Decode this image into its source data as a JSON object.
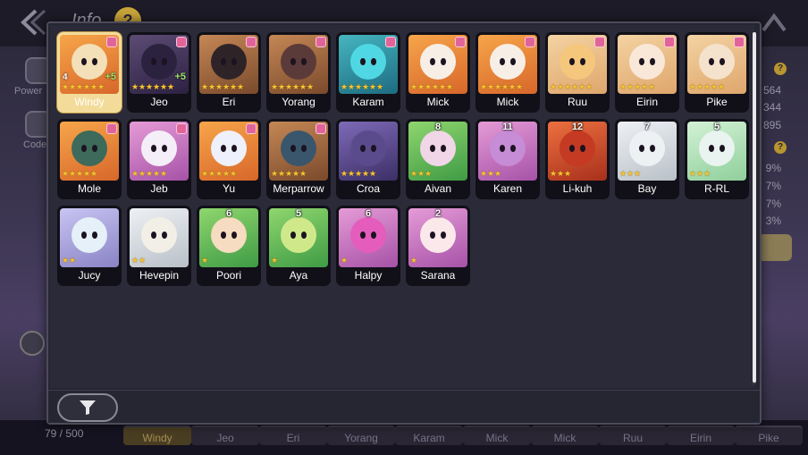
{
  "background": {
    "title": "Info",
    "help_glyph": "?",
    "side_items": [
      {
        "label": "Power",
        "icon": "power-icon"
      },
      {
        "label": "Code",
        "icon": "codex-icon"
      }
    ],
    "right_values": [
      "564",
      "344",
      "895",
      "9%",
      "7%",
      "7%",
      "3%"
    ],
    "collection_count": "79 / 500",
    "bottom_names": [
      "Windy",
      "Jeo",
      "Eri",
      "Yorang",
      "Karam",
      "Mick",
      "Mick",
      "Ruu",
      "Eirin",
      "Pike"
    ]
  },
  "modal": {
    "filter_icon": "funnel-icon",
    "cards": [
      {
        "name": "Windy",
        "stars": 6,
        "star_color": "gold",
        "level": "",
        "corner": "4",
        "plus": "+5",
        "theme": "t-orange",
        "blob": "#f3e0b8",
        "selected": true,
        "mark": true
      },
      {
        "name": "Jeo",
        "stars": 6,
        "star_color": "gold",
        "level": "",
        "corner": "",
        "plus": "+5",
        "theme": "t-dark",
        "blob": "#2b2240",
        "selected": false,
        "mark": true
      },
      {
        "name": "Eri",
        "stars": 6,
        "star_color": "gold",
        "level": "",
        "corner": "",
        "plus": "",
        "theme": "t-brown",
        "blob": "#2e2428",
        "selected": false,
        "mark": true
      },
      {
        "name": "Yorang",
        "stars": 6,
        "star_color": "gold",
        "level": "",
        "corner": "",
        "plus": "",
        "theme": "t-brown",
        "blob": "#5b3a3a",
        "selected": false,
        "mark": true
      },
      {
        "name": "Karam",
        "stars": 6,
        "star_color": "gold",
        "level": "",
        "corner": "",
        "plus": "",
        "theme": "t-teal",
        "blob": "#4fd8e3",
        "selected": false,
        "mark": true
      },
      {
        "name": "Mick",
        "stars": 6,
        "star_color": "gold",
        "level": "",
        "corner": "",
        "plus": "",
        "theme": "t-orange",
        "blob": "#f7efe6",
        "selected": false,
        "mark": true
      },
      {
        "name": "Mick",
        "stars": 6,
        "star_color": "gold",
        "level": "",
        "corner": "",
        "plus": "",
        "theme": "t-orange",
        "blob": "#f7efe6",
        "selected": false,
        "mark": true
      },
      {
        "name": "Ruu",
        "stars": 6,
        "star_color": "gold",
        "level": "",
        "corner": "",
        "plus": "",
        "theme": "t-cream",
        "blob": "#f5c77c",
        "selected": false,
        "mark": true
      },
      {
        "name": "Eirin",
        "stars": 5,
        "star_color": "gold",
        "level": "",
        "corner": "",
        "plus": "",
        "theme": "t-cream",
        "blob": "#f9e7d8",
        "selected": false,
        "mark": true
      },
      {
        "name": "Pike",
        "stars": 5,
        "star_color": "gold",
        "level": "",
        "corner": "",
        "plus": "",
        "theme": "t-cream",
        "blob": "#f5e2cc",
        "selected": false,
        "mark": true
      },
      {
        "name": "Mole",
        "stars": 5,
        "star_color": "gold",
        "level": "",
        "corner": "",
        "plus": "",
        "theme": "t-orange",
        "blob": "#3d6a5a",
        "selected": false,
        "mark": true
      },
      {
        "name": "Jeb",
        "stars": 5,
        "star_color": "gold",
        "level": "",
        "corner": "",
        "plus": "",
        "theme": "t-pink",
        "blob": "#f4eef8",
        "selected": false,
        "mark": true
      },
      {
        "name": "Yu",
        "stars": 5,
        "star_color": "gold",
        "level": "",
        "corner": "",
        "plus": "",
        "theme": "t-orange",
        "blob": "#eef0fb",
        "selected": false,
        "mark": true
      },
      {
        "name": "Merparrow",
        "stars": 5,
        "star_color": "gold",
        "level": "",
        "corner": "",
        "plus": "",
        "theme": "t-brown",
        "blob": "#3a566d",
        "selected": false,
        "mark": true
      },
      {
        "name": "Croa",
        "stars": 5,
        "star_color": "gold",
        "level": "",
        "corner": "",
        "plus": "",
        "theme": "t-violet",
        "blob": "#5a4c8c",
        "selected": false,
        "mark": false
      },
      {
        "name": "Aivan",
        "stars": 3,
        "star_color": "gold",
        "level": "8",
        "corner": "",
        "plus": "",
        "theme": "t-green",
        "blob": "#f0d6e6",
        "selected": false,
        "mark": false
      },
      {
        "name": "Karen",
        "stars": 3,
        "star_color": "gold",
        "level": "11",
        "corner": "",
        "plus": "",
        "theme": "t-pink",
        "blob": "#c68cd6",
        "selected": false,
        "mark": false
      },
      {
        "name": "Li-kuh",
        "stars": 3,
        "star_color": "gold",
        "level": "12",
        "corner": "",
        "plus": "",
        "theme": "t-red",
        "blob": "#c43a22",
        "selected": false,
        "mark": false
      },
      {
        "name": "Bay",
        "stars": 3,
        "star_color": "gold",
        "level": "7",
        "corner": "",
        "plus": "",
        "theme": "t-white",
        "blob": "#eef1f4",
        "selected": false,
        "mark": false
      },
      {
        "name": "R-RL",
        "stars": 3,
        "star_color": "gold",
        "level": "5",
        "corner": "",
        "plus": "",
        "theme": "t-mint",
        "blob": "#e9f3ef",
        "selected": false,
        "mark": false
      },
      {
        "name": "Jucy",
        "stars": 2,
        "star_color": "gold",
        "level": "",
        "corner": "",
        "plus": "",
        "theme": "t-lav",
        "blob": "#e6f0f8",
        "selected": false,
        "mark": false
      },
      {
        "name": "Hevepin",
        "stars": 2,
        "star_color": "gold",
        "level": "",
        "corner": "",
        "plus": "",
        "theme": "t-white",
        "blob": "#f2efe6",
        "selected": false,
        "mark": false
      },
      {
        "name": "Poori",
        "stars": 1,
        "star_color": "gold",
        "level": "6",
        "corner": "",
        "plus": "",
        "theme": "t-green",
        "blob": "#f6dcc0",
        "selected": false,
        "mark": false
      },
      {
        "name": "Aya",
        "stars": 1,
        "star_color": "gold",
        "level": "5",
        "corner": "",
        "plus": "",
        "theme": "t-green",
        "blob": "#cfe98a",
        "selected": false,
        "mark": false
      },
      {
        "name": "Halpy",
        "stars": 1,
        "star_color": "gold",
        "level": "6",
        "corner": "",
        "plus": "",
        "theme": "t-pink",
        "blob": "#e45cbc",
        "selected": false,
        "mark": false
      },
      {
        "name": "Sarana",
        "stars": 1,
        "star_color": "gold",
        "level": "2",
        "corner": "",
        "plus": "",
        "theme": "t-pink",
        "blob": "#fbe8ea",
        "selected": false,
        "mark": false
      }
    ]
  }
}
